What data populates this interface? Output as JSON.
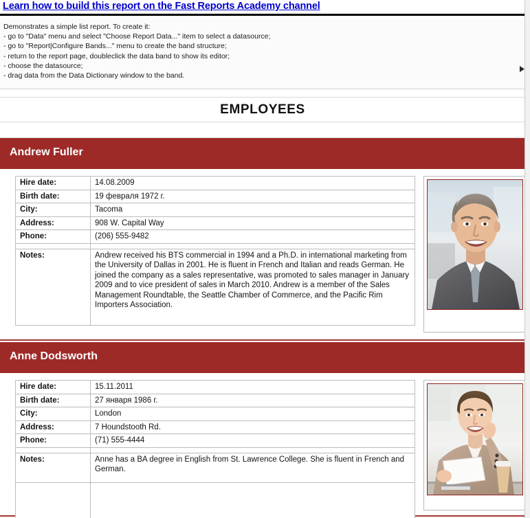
{
  "window": {
    "app_title": "FastReport Preview - Simple List Report",
    "page_background": "#ededed",
    "paper_background": "#ffffff"
  },
  "link_band": {
    "text": "Learn how to build this report on the Fast Reports Academy channel",
    "color": "#0000cc"
  },
  "description_band": {
    "lines": [
      "Demonstrates a simple list report. To create it:",
      "- go to \"Data\" menu and select \"Choose Report Data...\" item to select a datasource;",
      "- go to \"Report|Configure Bands...\" menu to create the band structure;",
      "- return to the report page, doubleclick the data band to show its editor;",
      "- choose the datasource;",
      "- drag data from the Data Dictionary window to the band."
    ]
  },
  "report": {
    "title": "EMPLOYEES",
    "header_color": "#9e2a28",
    "labels": {
      "hire_date": "Hire date:",
      "birth_date": "Birth date:",
      "city": "City:",
      "address": "Address:",
      "phone": "Phone:",
      "notes": "Notes:"
    },
    "employees": [
      {
        "name": "Andrew Fuller",
        "hire_date": "14.08.2009",
        "birth_date": "19 февраля 1972 г.",
        "city": "Tacoma",
        "address": "908 W. Capital Way",
        "phone": "(206) 555-9482",
        "notes": "Andrew received his BTS commercial in 1994 and a Ph.D. in international marketing from the University of Dallas in 2001.  He is fluent in French and Italian and reads German.  He joined the company as a sales representative, was promoted to sales manager in January 2009 and to vice president of sales in March 2010.  Andrew is a member of the Sales Management Roundtable, the Seattle Chamber of Commerce, and the Pacific Rim Importers Association.",
        "photo_alt": "photo of a smiling middle-aged man in a grey suit and tie"
      },
      {
        "name": "Anne Dodsworth",
        "hire_date": "15.11.2011",
        "birth_date": "27 января 1986 г.",
        "city": "London",
        "address": "7 Houndstooth Rd.",
        "phone": "(71) 555-4444",
        "notes": "Anne has a BA degree in English from St. Lawrence College.  She is fluent in French and German.",
        "photo_alt": "photo of a smiling young woman in a beige blazer holding a sheet of paper at a desk with a coffee cup"
      }
    ]
  }
}
